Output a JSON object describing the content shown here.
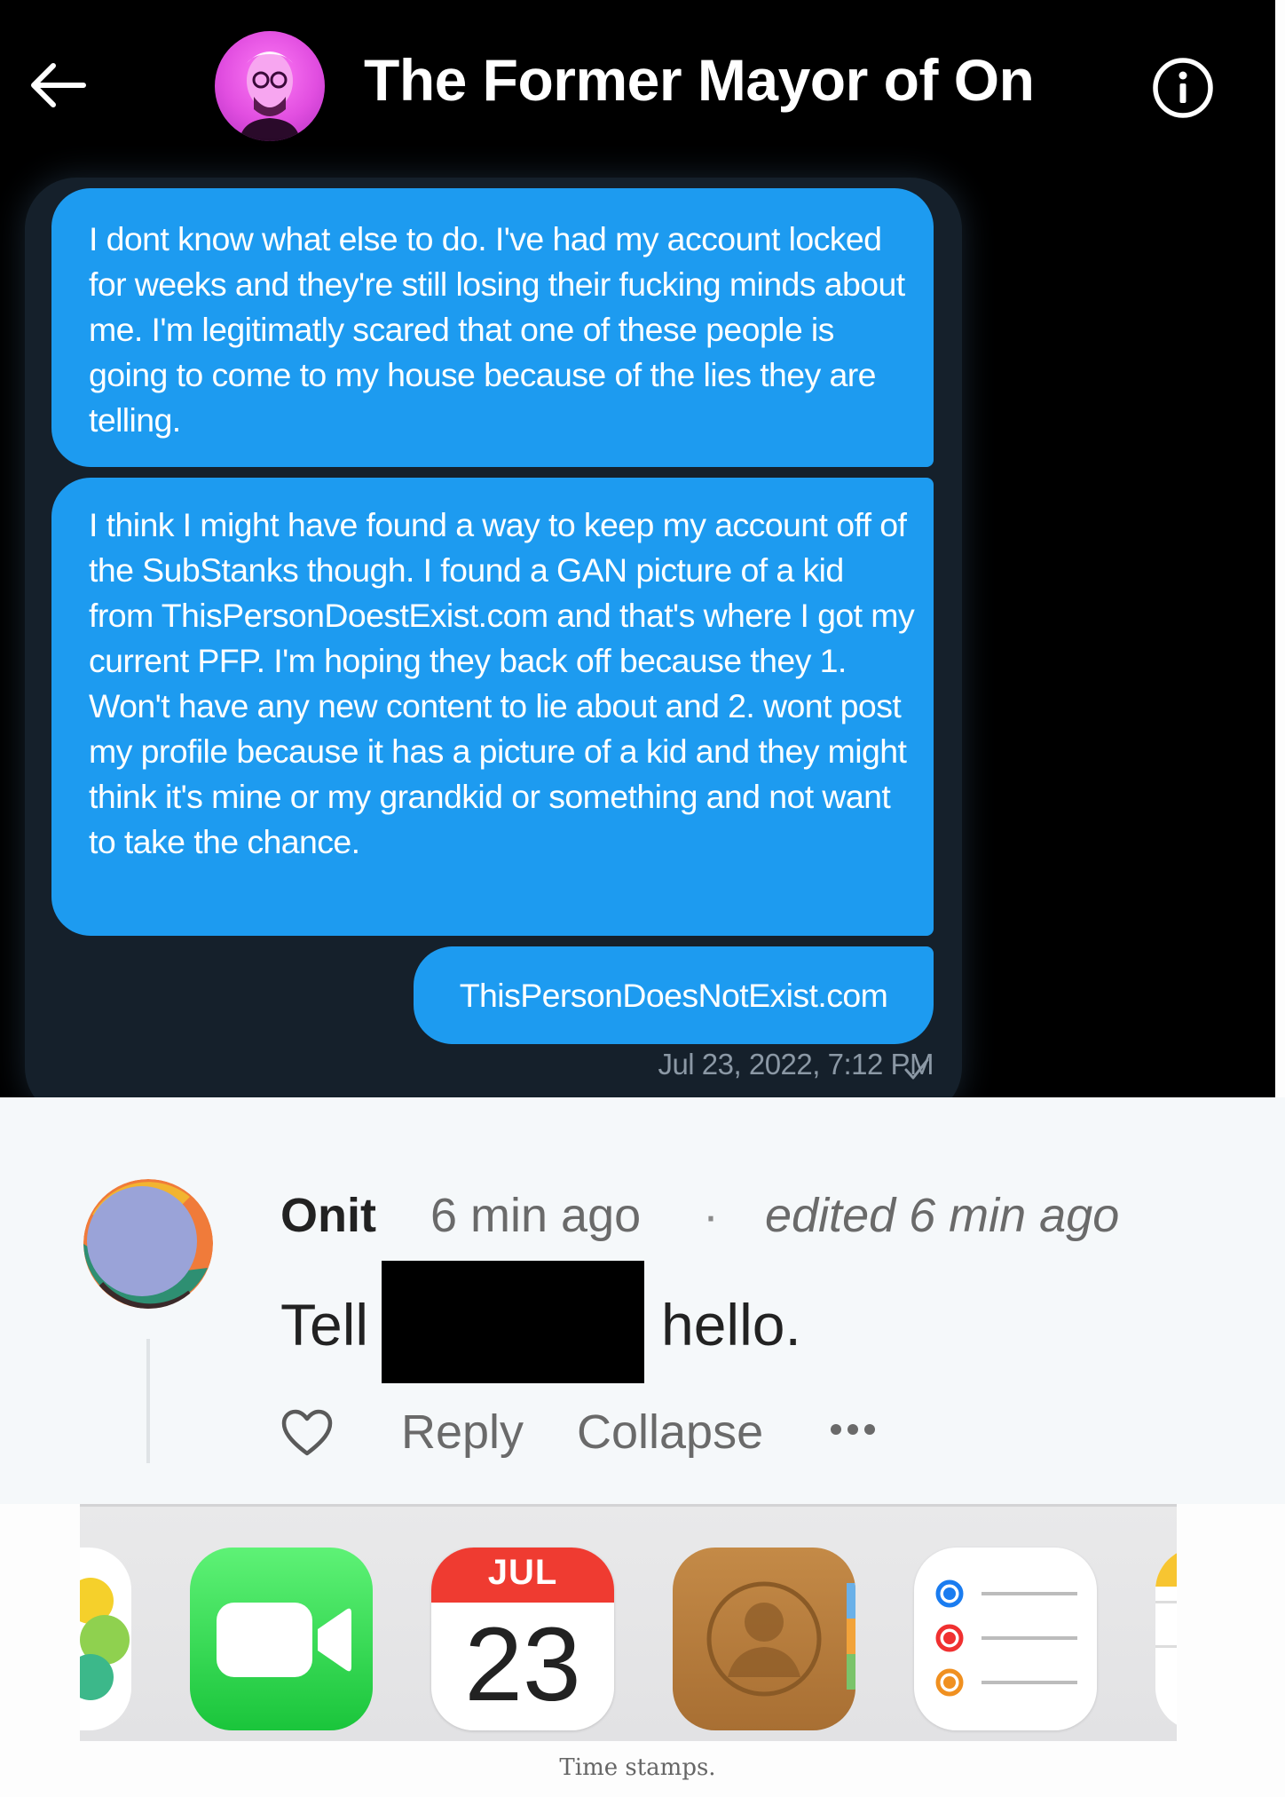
{
  "dm": {
    "title": "The Former Mayor of On",
    "messages": [
      "I dont know what else to do. I've had my account locked for weeks and they're still losing their fucking minds about me. I'm legitimatly scared that one of these people is going to come to my house because of the lies they are telling.",
      "I think I might have found a way to keep my account off of the SubStanks though. I found a GAN picture of a kid from ThisPersonDoestExist.com and that's where I got my current PFP. I'm hoping they back off because they 1. Won't have any new content to lie about and 2. wont post my profile because it has a picture of a kid and they might think it's mine or my grandkid or something and not want to take the chance.",
      "ThisPersonDoesNotExist.com"
    ],
    "timestamp": "Jul 23, 2022, 7:12 PM",
    "bubble_color": "#1d9bf0",
    "icons": [
      "back-arrow-icon",
      "info-icon",
      "check-icon"
    ]
  },
  "comment": {
    "author": "Onit",
    "time": "6 min ago",
    "separator": "·",
    "edited": "edited 6 min ago",
    "text_before": "Tell",
    "text_after": "hello.",
    "actions": {
      "reply": "Reply",
      "collapse": "Collapse"
    },
    "icons": [
      "heart-icon",
      "more-icon"
    ]
  },
  "dock": {
    "apps": [
      "photos-icon",
      "facetime-icon",
      "calendar-icon",
      "contacts-icon",
      "reminders-icon",
      "notes-icon"
    ],
    "calendar_month": "JUL",
    "calendar_day": "23"
  },
  "caption": "Time stamps."
}
